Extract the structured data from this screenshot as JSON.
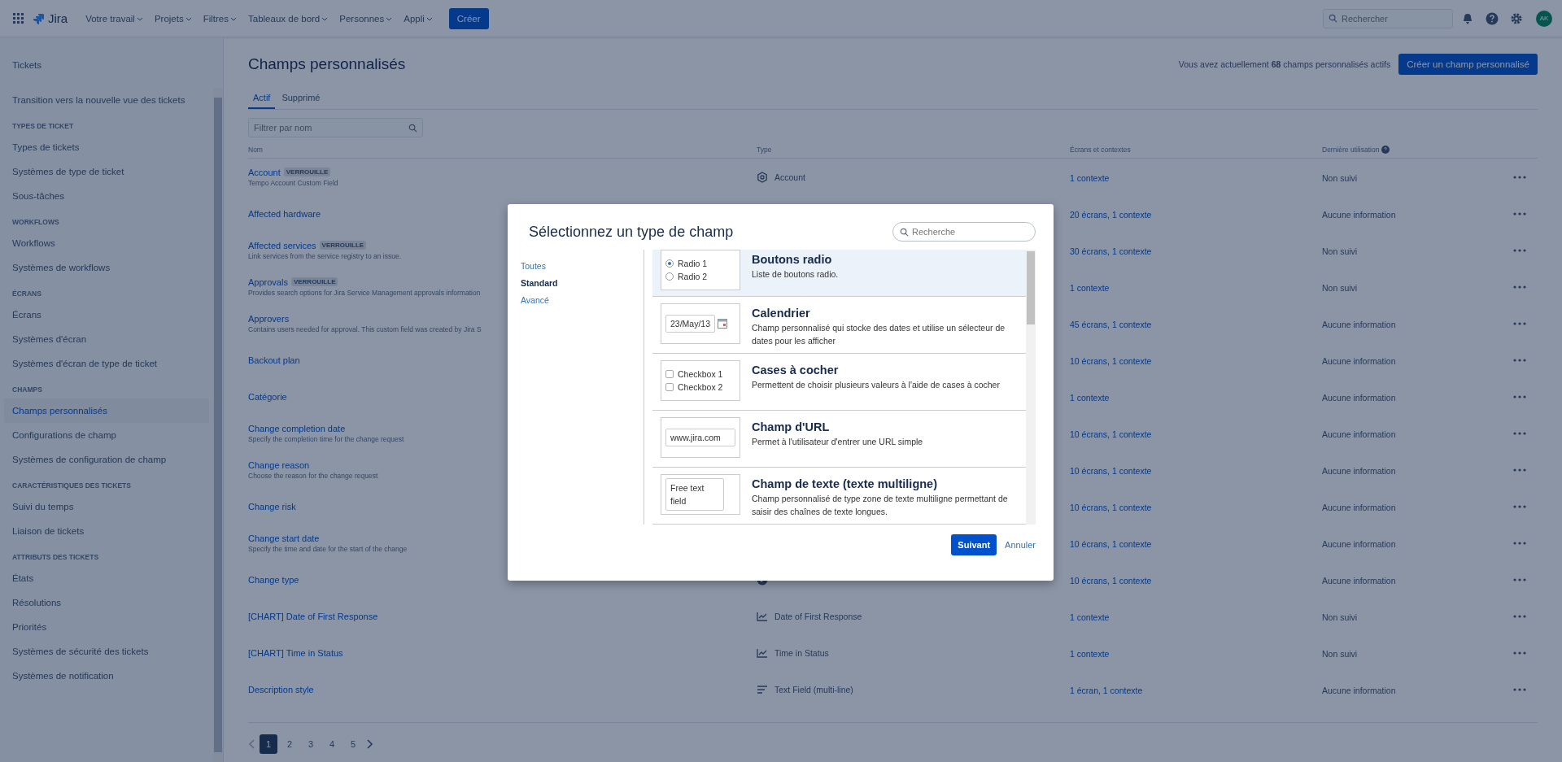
{
  "topbar": {
    "product": "Jira",
    "nav": [
      "Votre travail",
      "Projets",
      "Filtres",
      "Tableaux de bord",
      "Personnes",
      "Appli"
    ],
    "create": "Créer",
    "search_placeholder": "Rechercher",
    "avatar": "AK"
  },
  "sidebar": {
    "title": "Tickets",
    "sections": [
      {
        "items": [
          {
            "label": "Transition vers la nouvelle vue des tickets",
            "selected": false
          }
        ]
      },
      {
        "heading": "TYPES DE TICKET",
        "items": [
          {
            "label": "Types de tickets",
            "selected": false
          },
          {
            "label": "Systèmes de type de ticket",
            "selected": false
          },
          {
            "label": "Sous-tâches",
            "selected": false
          }
        ]
      },
      {
        "heading": "WORKFLOWS",
        "items": [
          {
            "label": "Workflows",
            "selected": false
          },
          {
            "label": "Systèmes de workflows",
            "selected": false
          }
        ]
      },
      {
        "heading": "ÉCRANS",
        "items": [
          {
            "label": "Écrans",
            "selected": false
          },
          {
            "label": "Systèmes d'écran",
            "selected": false
          },
          {
            "label": "Systèmes d'écran de type de ticket",
            "selected": false
          }
        ]
      },
      {
        "heading": "CHAMPS",
        "items": [
          {
            "label": "Champs personnalisés",
            "selected": true
          },
          {
            "label": "Configurations de champ",
            "selected": false
          },
          {
            "label": "Systèmes de configuration de champ",
            "selected": false
          }
        ]
      },
      {
        "heading": "CARACTÉRISTIQUES DES TICKETS",
        "items": [
          {
            "label": "Suivi du temps",
            "selected": false
          },
          {
            "label": "Liaison de tickets",
            "selected": false
          }
        ]
      },
      {
        "heading": "ATTRIBUTS DES TICKETS",
        "items": [
          {
            "label": "États",
            "selected": false
          },
          {
            "label": "Résolutions",
            "selected": false
          },
          {
            "label": "Priorités",
            "selected": false
          },
          {
            "label": "Systèmes de sécurité des tickets",
            "selected": false
          },
          {
            "label": "Systèmes de notification",
            "selected": false
          }
        ]
      }
    ]
  },
  "page": {
    "title": "Champs personnalisés",
    "count_text": "Vous avez actuellement **68** champs personnalisés actifs",
    "create_button": "Créer un champ personnalisé",
    "tabs": [
      {
        "label": "Actif",
        "selected": true
      },
      {
        "label": "Supprimé",
        "selected": false
      }
    ],
    "filter_placeholder": "Filtrer par nom",
    "columns": [
      "Nom",
      "Type",
      "Écrans et contextes",
      "Dernière utilisation"
    ],
    "rows": [
      {
        "name": "Account",
        "locked": "VERROUILLE",
        "description": "Tempo Account Custom Field",
        "kind": "account",
        "type": "Account",
        "contexts": "1 contexte",
        "last_used": "Non suivi"
      },
      {
        "name": "Affected hardware",
        "contexts": "20 écrans, 1 contexte",
        "last_used": "Aucune information"
      },
      {
        "name": "Affected services",
        "locked": "VERROUILLE",
        "description": "Link services from the service registry to an issue.",
        "contexts": "30 écrans, 1 contexte",
        "last_used": "Non suivi"
      },
      {
        "name": "Approvals",
        "locked": "VERROUILLE",
        "description": "Provides search options for Jira Service Management approvals information",
        "contexts": "1 contexte",
        "last_used": "Non suivi"
      },
      {
        "name": "Approvers",
        "description": "Contains users needed for approval. This custom field was created by Jira S",
        "contexts": "45 écrans, 1 contexte",
        "last_used": "Aucune information"
      },
      {
        "name": "Backout plan",
        "contexts": "10 écrans, 1 contexte",
        "last_used": "Aucune information"
      },
      {
        "name": "Catégorie",
        "contexts": "1 contexte",
        "last_used": "Aucune information"
      },
      {
        "name": "Change completion date",
        "description": "Specify the completion time for the change request",
        "contexts": "10 écrans, 1 contexte",
        "last_used": "Aucune information"
      },
      {
        "name": "Change reason",
        "description": "Choose the reason for the change request",
        "contexts": "10 écrans, 1 contexte",
        "last_used": "Aucune information"
      },
      {
        "name": "Change risk",
        "contexts": "10 écrans, 1 contexte",
        "last_used": "Aucune information"
      },
      {
        "name": "Change start date",
        "description": "Specify the time and date for the start of the change",
        "contexts": "10 écrans, 1 contexte",
        "last_used": "Aucune information"
      },
      {
        "name": "Change type",
        "kind": "select",
        "contexts": "10 écrans, 1 contexte",
        "last_used": "Aucune information"
      },
      {
        "name": "[CHART] Date of First Response",
        "kind": "chart",
        "type": "Date of First Response",
        "contexts": "1 contexte",
        "last_used": "Non suivi"
      },
      {
        "name": "[CHART] Time in Status",
        "kind": "chart",
        "type": "Time in Status",
        "contexts": "1 contexte",
        "last_used": "Non suivi"
      },
      {
        "name": "Description style",
        "kind": "text",
        "type": "Text Field (multi-line)",
        "contexts": "1 écran, 1 contexte",
        "last_used": "Aucune information"
      }
    ],
    "pages": [
      {
        "label": "1",
        "selected": true
      },
      {
        "label": "2",
        "selected": false
      },
      {
        "label": "3",
        "selected": false
      },
      {
        "label": "4",
        "selected": false
      },
      {
        "label": "5",
        "selected": false
      }
    ]
  },
  "modal": {
    "title": "Sélectionnez un type de champ",
    "search_placeholder": "Recherche",
    "categories": [
      {
        "label": "Toutes",
        "selected": false
      },
      {
        "label": "Standard",
        "selected": true
      },
      {
        "label": "Avancé",
        "selected": false
      }
    ],
    "types": [
      {
        "kind": "radio",
        "name": "Boutons radio",
        "description": "Liste de boutons radio.",
        "selected": true,
        "options": [
          {
            "label": "Radio 1",
            "checked": true
          },
          {
            "label": "Radio 2",
            "checked": false
          }
        ]
      },
      {
        "kind": "date",
        "name": "Calendrier",
        "description": "Champ personnalisé qui stocke des dates et utilise un sélecteur de dates pour les afficher",
        "selected": false,
        "value": "23/May/13"
      },
      {
        "kind": "checkbox",
        "name": "Cases à cocher",
        "description": "Permettent de choisir plusieurs valeurs à l'aide de cases à cocher",
        "selected": false,
        "options": [
          {
            "label": "Checkbox 1",
            "checked": false
          },
          {
            "label": "Checkbox 2",
            "checked": false
          }
        ]
      },
      {
        "kind": "url",
        "name": "Champ d'URL",
        "description": "Permet à l'utilisateur d'entrer une URL simple",
        "selected": false,
        "value": "www.jira.com"
      },
      {
        "kind": "textarea",
        "name": "Champ de texte (texte multiligne)",
        "description": "Champ personnalisé de type zone de texte multiligne permettant de saisir des chaînes de texte longues.",
        "selected": false,
        "value": "Free text field"
      }
    ],
    "next": "Suivant",
    "cancel": "Annuler"
  }
}
